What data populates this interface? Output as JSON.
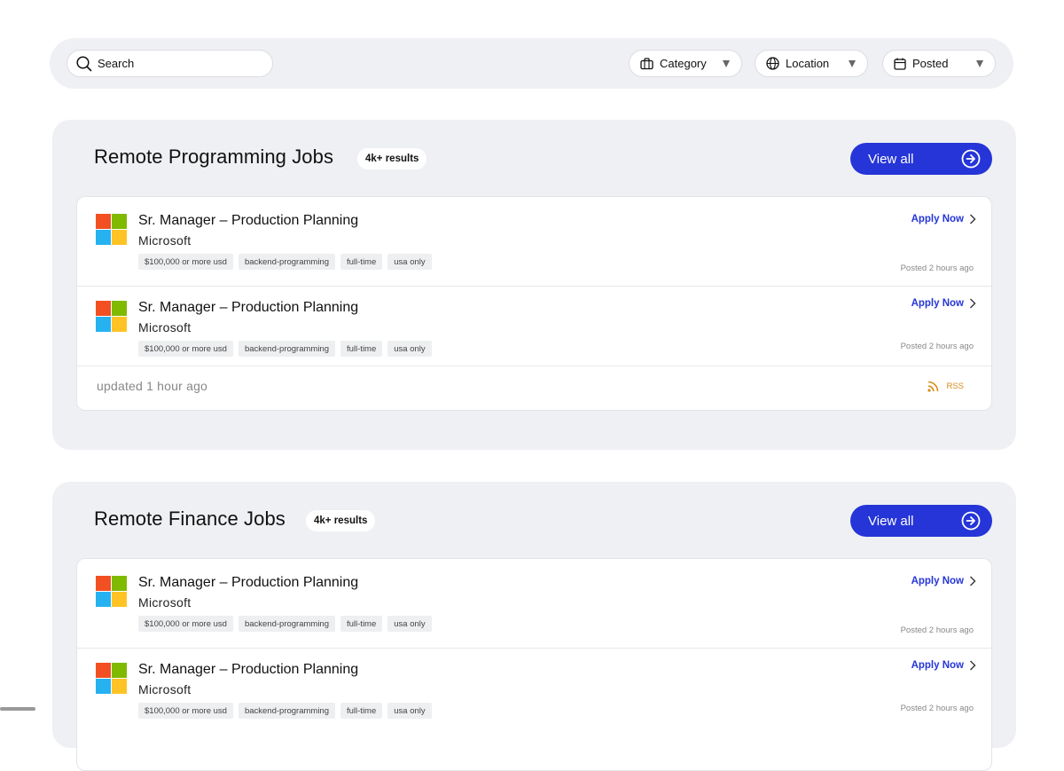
{
  "filters": {
    "search_placeholder": "Search",
    "category_label": "Category",
    "location_label": "Location",
    "posted_label": "Posted"
  },
  "colors": {
    "accent": "#2535d8",
    "rss": "#d98a16",
    "panel": "#eff0f3"
  },
  "sections": [
    {
      "title": "Remote Programming Jobs",
      "badge": "4k+ results",
      "view_all": "View all",
      "jobs": [
        {
          "title": "Sr. Manager – Production Planning",
          "company": "Microsoft",
          "tags": [
            "$100,000 or more usd",
            "backend-programming",
            "full-time",
            "usa only"
          ],
          "apply": "Apply Now",
          "posted": "Posted 2 hours ago"
        },
        {
          "title": "Sr. Manager – Production Planning",
          "company": "Microsoft",
          "tags": [
            "$100,000 or more usd",
            "backend-programming",
            "full-time",
            "usa only"
          ],
          "apply": "Apply Now",
          "posted": "Posted 2 hours ago"
        }
      ],
      "footer": {
        "updated": "updated 1 hour ago",
        "rss": "RSS"
      }
    },
    {
      "title": "Remote Finance Jobs",
      "badge": "4k+ results",
      "view_all": "View all",
      "jobs": [
        {
          "title": "Sr. Manager – Production Planning",
          "company": "Microsoft",
          "tags": [
            "$100,000 or more usd",
            "backend-programming",
            "full-time",
            "usa only"
          ],
          "apply": "Apply Now",
          "posted": "Posted 2 hours ago"
        },
        {
          "title": "Sr. Manager – Production Planning",
          "company": "Microsoft",
          "tags": [
            "$100,000 or more usd",
            "backend-programming",
            "full-time",
            "usa only"
          ],
          "apply": "Apply Now",
          "posted": "Posted 2 hours ago"
        }
      ]
    }
  ],
  "icons": {
    "search": "search-icon",
    "category": "briefcase-icon",
    "location": "globe-icon",
    "posted": "calendar-icon",
    "view_all": "arrow-circle-right-icon",
    "apply": "chevron-right-icon",
    "rss": "rss-icon",
    "logo": "microsoft-logo"
  }
}
